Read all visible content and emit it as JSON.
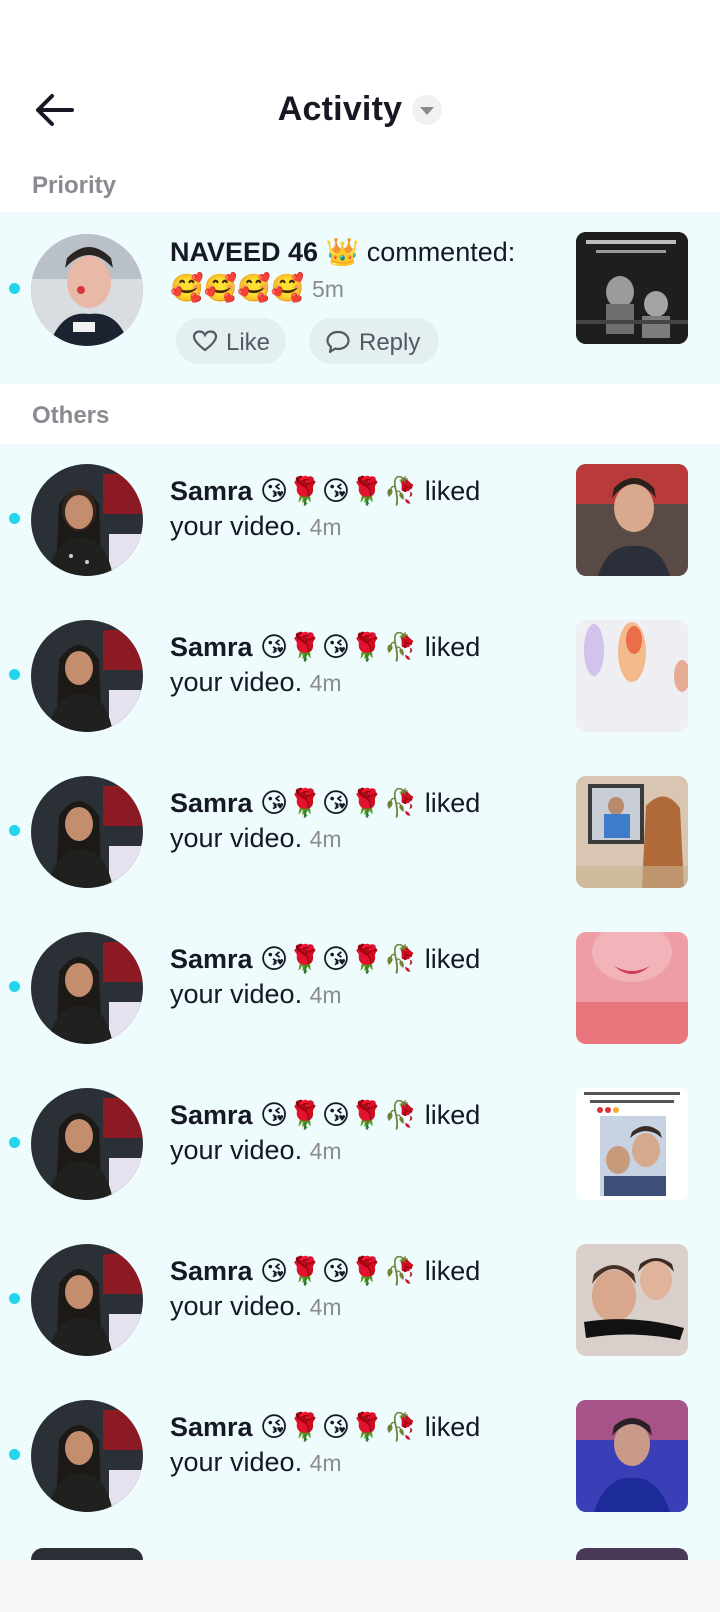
{
  "header": {
    "title": "Activity"
  },
  "sections": {
    "priority": "Priority",
    "others": "Others"
  },
  "priority_item": {
    "name": "NAVEED 46 👑",
    "action": "commented:",
    "comment": "🥰🥰🥰🥰",
    "time": "5m",
    "like_label": "Like",
    "reply_label": "Reply"
  },
  "activity": {
    "name": "Samra 😘🌹😘🌹🥀",
    "action": "liked",
    "line2": "your video.",
    "time": "4m"
  },
  "colors": {
    "accent_dot": "#20d5ec",
    "row_background": "#effcfd",
    "secondary_text": "#8a8b91"
  }
}
